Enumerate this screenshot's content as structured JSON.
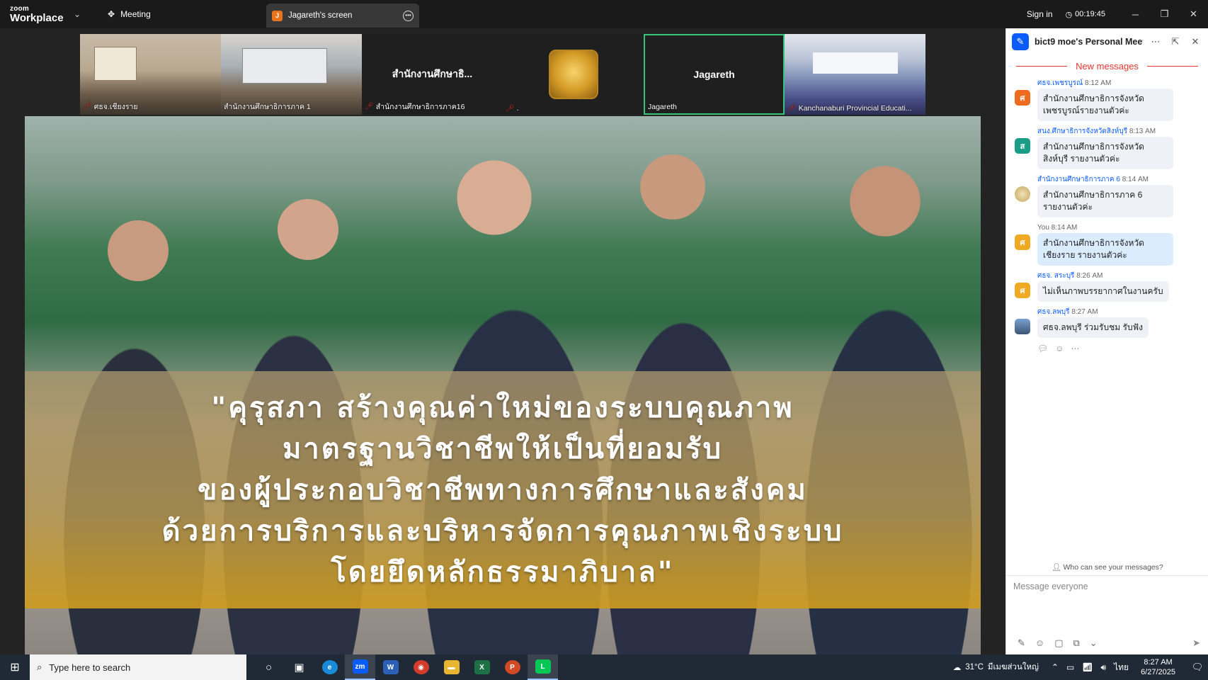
{
  "titlebar": {
    "logo_small": "zoom",
    "logo_big": "Workplace",
    "meeting_label": "Meeting",
    "screen_tab_badge": "J",
    "screen_tab_label": "Jagareth's screen",
    "signin": "Sign in",
    "timer": "00:19:45"
  },
  "participants": [
    {
      "name": "ศธจ.เชียงราย",
      "muted": true
    },
    {
      "name": "สำนักงานศึกษาธิการภาค 1",
      "muted": false
    },
    {
      "name": "สำนักงานศึกษาธิการภาค16",
      "center": "สำนักงานศึกษาธิ...",
      "muted": true
    },
    {
      "name": ".",
      "muted": true
    },
    {
      "name": "Jagareth",
      "center": "Jagareth",
      "muted": false
    },
    {
      "name": "Kanchanaburi Provincial Educati...",
      "muted": true
    }
  ],
  "shared_screen": {
    "lines": [
      "\"คุรุสภา สร้างคุณค่าใหม่ของระบบคุณภาพ",
      "มาตรฐานวิชาชีพให้เป็นที่ยอมรับ",
      "ของผู้ประกอบวิชาชีพทางการศึกษาและสังคม",
      "ด้วยการบริการและบริหารจัดการคุณภาพเชิงระบบ",
      "โดยยึดหลักธรรมาภิบาล\""
    ]
  },
  "chat": {
    "title": "bict9 moe's Personal Meetin...",
    "new_messages": "New messages",
    "messages": [
      {
        "sender": "ศธจ.เพชรบูรณ์",
        "time": "8:12 AM",
        "text": "สำนักงานศึกษาธิการจังหวัดเพชรบูรณ์รายงานตัวค่ะ",
        "avatar": "ศ"
      },
      {
        "sender": "สนง.ศึกษาธิการจังหวัดสิงห์บุรี",
        "time": "8:13 AM",
        "text": "สำนักงานศึกษาธิการจังหวัดสิงห์บุรี รายงานตัวค่ะ",
        "avatar": "ส"
      },
      {
        "sender": "สำนักงานศึกษาธิการภาค 6",
        "time": "8:14 AM",
        "text": "สำนักงานศึกษาธิการภาค 6 รายงานตัวค่ะ",
        "avatar": ""
      },
      {
        "sender": "You",
        "time": "8:14 AM",
        "text": "สำนักงานศึกษาธิการจังหวัดเชียงราย รายงานตัวค่ะ",
        "avatar": "ศ"
      },
      {
        "sender": "ศธจ. สระบุรี",
        "time": "8:26 AM",
        "text": "ไม่เห็นภาพบรรยากาศในงานครับ",
        "avatar": "ศ"
      },
      {
        "sender": "ศธจ.ลพบุรี",
        "time": "8:27 AM",
        "text": "ศธจ.ลพบุรี ร่วมรับชม รับฟัง",
        "avatar": ""
      }
    ],
    "who_can_see": "Who can see your messages?",
    "input_placeholder": "Message everyone"
  },
  "taskbar": {
    "search_placeholder": "Type here to search",
    "apps": [
      {
        "name": "task-view",
        "label": "◎"
      },
      {
        "name": "widgets",
        "label": "▦"
      },
      {
        "name": "edge",
        "label": "e"
      },
      {
        "name": "zoom",
        "label": "zm"
      },
      {
        "name": "word",
        "label": "W"
      },
      {
        "name": "chrome",
        "label": "◉"
      },
      {
        "name": "explorer",
        "label": "▬"
      },
      {
        "name": "excel",
        "label": "X"
      },
      {
        "name": "powerpoint",
        "label": "P"
      },
      {
        "name": "line",
        "label": "L"
      }
    ],
    "weather": "31°C",
    "weather_text": "มีเมฆส่วนใหญ่",
    "language": "ไทย",
    "time": "8:27 AM",
    "date": "6/27/2025"
  },
  "colors": {
    "accent": "#0b5cff",
    "active_speaker": "#36c47a",
    "new_messages": "#e8372f"
  }
}
